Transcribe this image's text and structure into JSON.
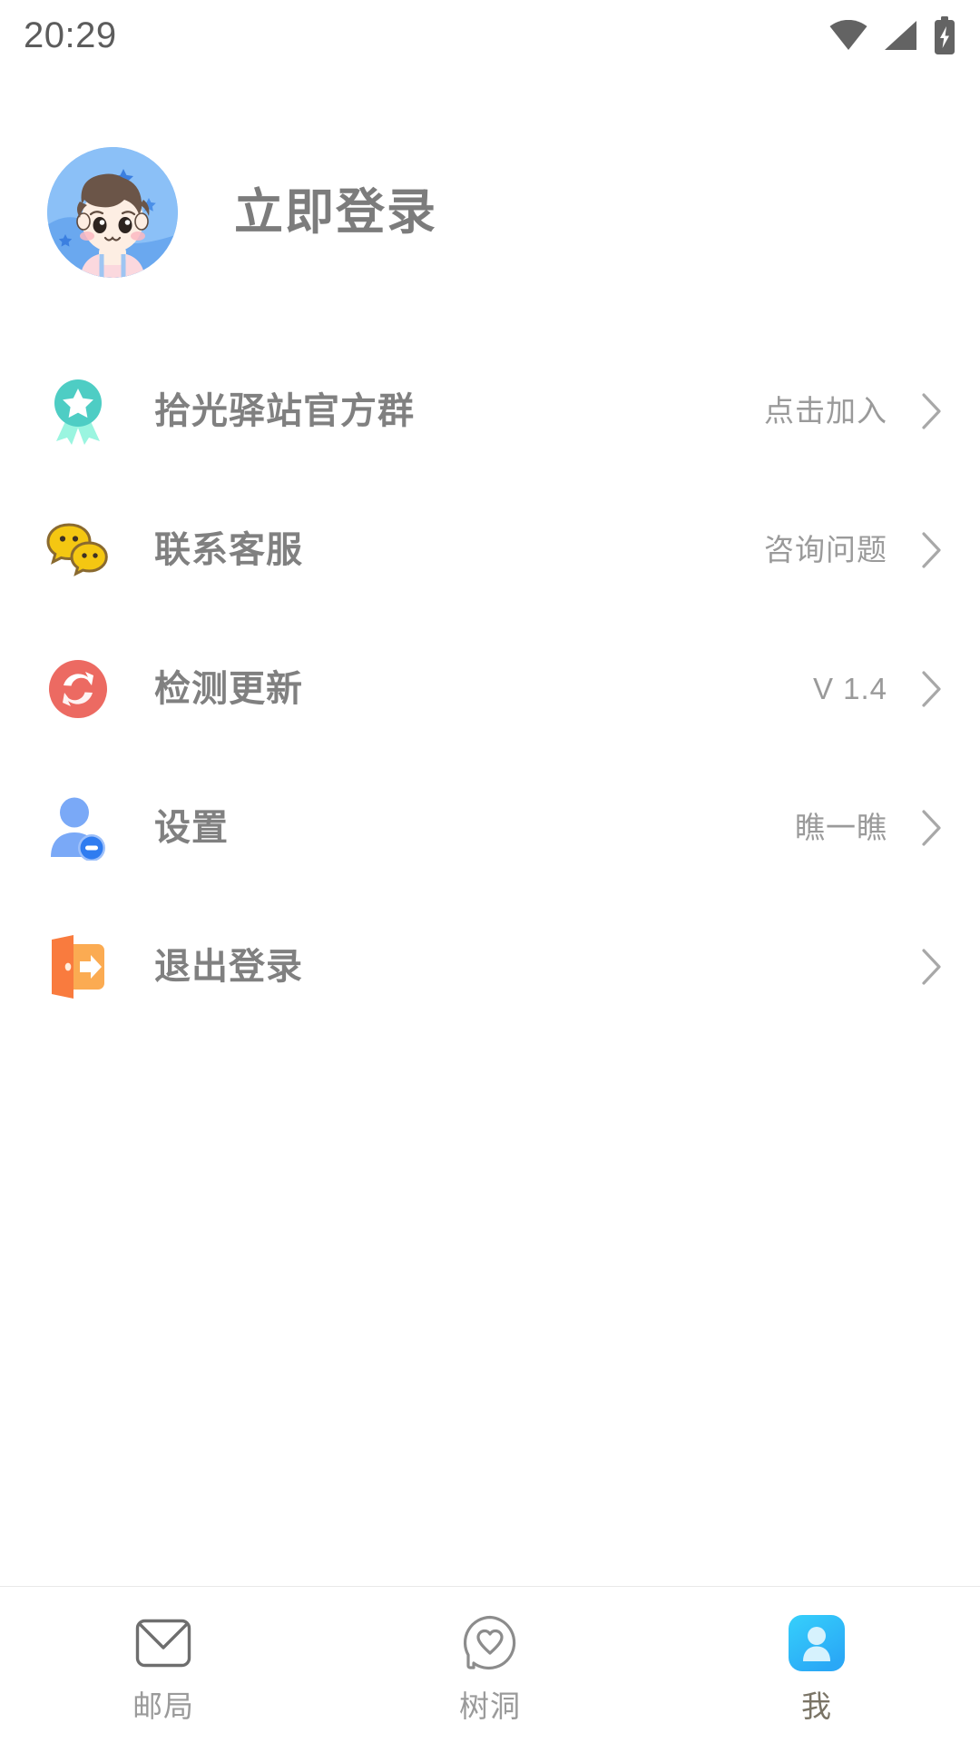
{
  "status_bar": {
    "time": "20:29",
    "icons": [
      {
        "name": "wifi-icon"
      },
      {
        "name": "cellular-signal-icon"
      },
      {
        "name": "battery-charging-icon"
      }
    ]
  },
  "profile": {
    "avatar_name": "user-avatar",
    "login_label": "立即登录"
  },
  "menu": {
    "rows": [
      {
        "icon": "medal-badge-icon",
        "label": "拾光驿站官方群",
        "value": "点击加入",
        "chevron": "chevron-right-icon"
      },
      {
        "icon": "wechat-bubbles-icon",
        "label": "联系客服",
        "value": "咨询问题",
        "chevron": "chevron-right-icon"
      },
      {
        "icon": "refresh-update-icon",
        "label": "检测更新",
        "value": "V 1.4",
        "chevron": "chevron-right-icon"
      },
      {
        "icon": "user-settings-icon",
        "label": "设置",
        "value": "瞧一瞧",
        "chevron": "chevron-right-icon"
      },
      {
        "icon": "logout-door-icon",
        "label": "退出登录",
        "value": "",
        "chevron": "chevron-right-icon"
      }
    ]
  },
  "tabbar": {
    "tabs": [
      {
        "icon": "envelope-icon",
        "label": "邮局",
        "active": false
      },
      {
        "icon": "heart-bubble-icon",
        "label": "树洞",
        "active": false
      },
      {
        "icon": "person-square-icon",
        "label": "我",
        "active": true
      }
    ]
  },
  "colors": {
    "medal_teal": "#4ecdc4",
    "medal_ribbon": "#9af5e0",
    "wechat_yellow": "#f4c712",
    "wechat_outline": "#8a6a2f",
    "update_red": "#ec6a62",
    "settings_blue": "#7aa9f7",
    "settings_badge": "#2f7cf0",
    "logout_orange_dark": "#f97b3e",
    "logout_orange_light": "#fbab52",
    "tab_active_blue": "#2fc6f8",
    "text_gray": "#808080",
    "value_gray": "#9a9a9a"
  }
}
